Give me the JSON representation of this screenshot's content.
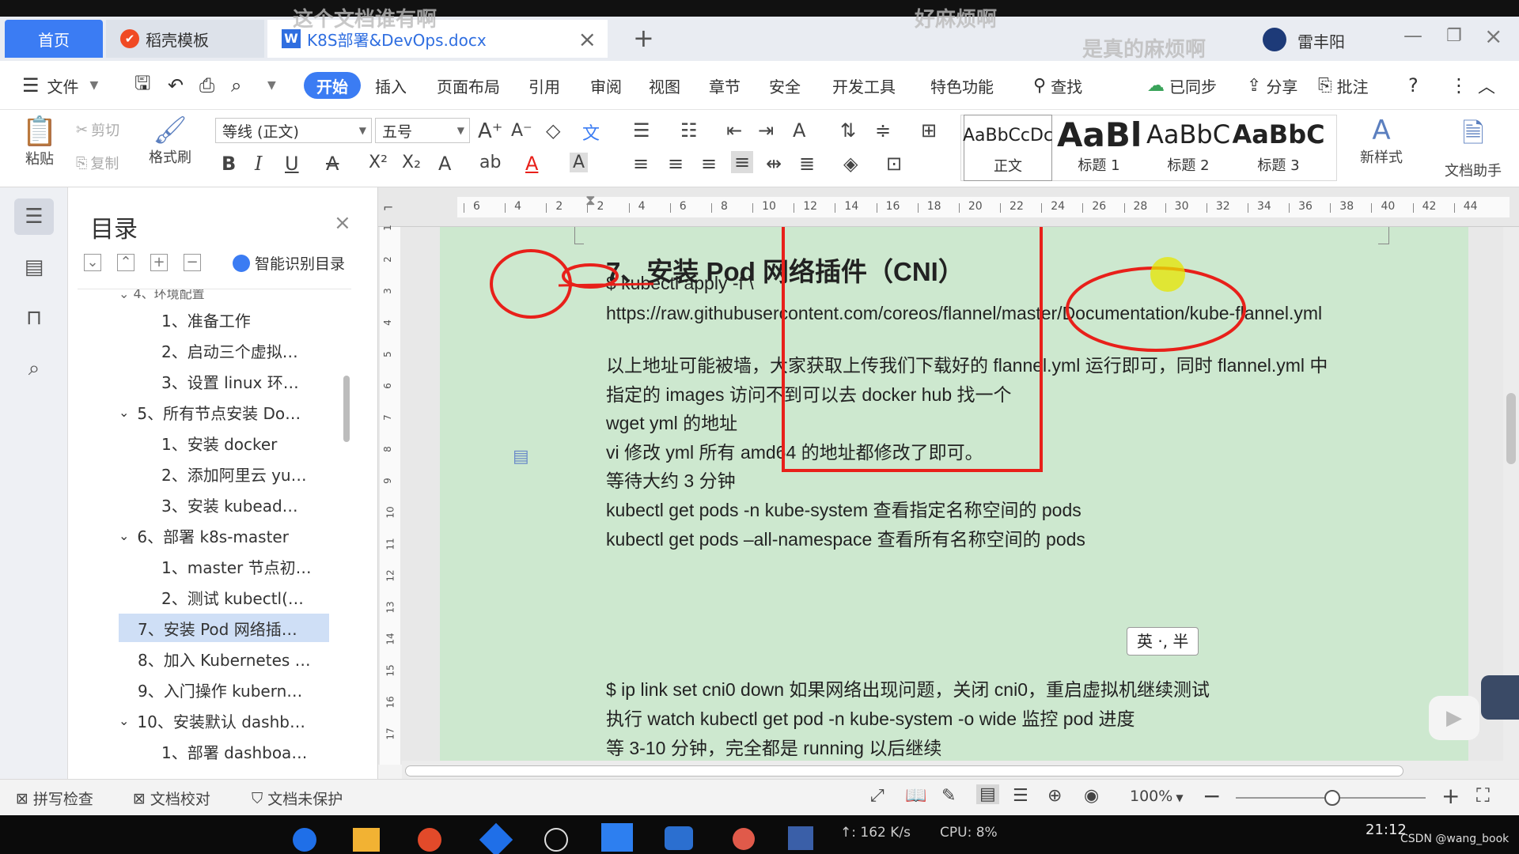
{
  "overlay": {
    "text1": "这个文档谁有啊",
    "text2": "好麻烦啊",
    "text3": "是真的麻烦啊"
  },
  "tabs": {
    "home": "首页",
    "template": "稻壳模板",
    "document": "K8S部署&DevOps.docx",
    "close": "×",
    "new": "+",
    "user": "雷丰阳"
  },
  "menu": {
    "file": "文件",
    "start": "开始",
    "insert": "插入",
    "layout": "页面布局",
    "reference": "引用",
    "review": "审阅",
    "view": "视图",
    "chapter": "章节",
    "security": "安全",
    "devtools": "开发工具",
    "features": "特色功能",
    "search": "查找",
    "synced": "已同步",
    "share": "分享",
    "comment": "批注"
  },
  "ribbon": {
    "paste": "粘贴",
    "cut": "剪切",
    "copy": "复制",
    "format_painter": "格式刷",
    "font_name": "等线 (正文)",
    "font_size": "五号",
    "styles": [
      {
        "preview": "AaBbCcDc",
        "label": "正文"
      },
      {
        "preview": "AaBl",
        "label": "标题 1"
      },
      {
        "preview": "AaBbC",
        "label": "标题 2"
      },
      {
        "preview": "AaBbC",
        "label": "标题 3"
      }
    ],
    "new_style": "新样式",
    "doc_assistant": "文档助手"
  },
  "toc": {
    "title": "目录",
    "smart": "智能识别目录",
    "items": [
      {
        "label": "1、准备工作"
      },
      {
        "label": "2、启动三个虚拟…"
      },
      {
        "label": "3、设置 linux 环…"
      },
      {
        "label": "5、所有节点安装 Do…"
      },
      {
        "label": "1、安装 docker"
      },
      {
        "label": "2、添加阿里云 yu…"
      },
      {
        "label": "3、安装 kubead…"
      },
      {
        "label": "6、部署 k8s-master"
      },
      {
        "label": "1、master 节点初…"
      },
      {
        "label": "2、测试 kubectl(…"
      },
      {
        "label": "7、安装 Pod 网络插…"
      },
      {
        "label": "8、加入 Kubernetes …"
      },
      {
        "label": "9、入门操作 kubern…"
      },
      {
        "label": "10、安装默认 dashb…"
      },
      {
        "label": "1、部署 dashboa…"
      }
    ]
  },
  "ruler": {
    "ticks": [
      "6",
      "4",
      "2",
      "2",
      "4",
      "6",
      "8",
      "10",
      "12",
      "14",
      "16",
      "18",
      "20",
      "22",
      "24",
      "26",
      "28",
      "30",
      "32",
      "34",
      "36",
      "38",
      "40",
      "42",
      "44"
    ],
    "vticks": [
      "1",
      "2",
      "3",
      "4",
      "5",
      "6",
      "7",
      "8",
      "9",
      "10",
      "11",
      "12",
      "13",
      "14",
      "15",
      "16",
      "17"
    ]
  },
  "doc": {
    "heading": "7、安装 Pod 网络插件（CNI）",
    "line1": "$ kubectl apply -f \\",
    "line2": "https://raw.githubusercontent.com/coreos/flannel/master/Documentation/kube-flannel.yml",
    "line3": "以上地址可能被墙，大家获取上传我们下载好的 flannel.yml 运行即可，同时 flannel.yml 中",
    "line4": "指定的 images 访问不到可以去 docker hub 找一个",
    "line5": "wget yml 的地址",
    "line6": "vi 修改 yml    所有 amd64 的地址都修改了即可。",
    "line7": "等待大约 3 分钟",
    "line8": "kubectl get pods -n kube-system  查看指定名称空间的 pods",
    "line9": "kubectl get pods –all-namespace  查看所有名称空间的 pods",
    "line10": "$ ip link set cni0 down  如果网络出现问题，关闭 cni0，重启虚拟机继续测试",
    "line11": "执行  watch kubectl get pod -n kube-system -o wide  监控 pod 进度",
    "line12": "等 3-10 分钟，完全都是 running 以后继续",
    "ime": "英 ·, 半"
  },
  "status": {
    "spell": "拼写检查",
    "proof": "文档校对",
    "unprotected": "文档未保护",
    "zoom": "100%"
  },
  "taskbar": {
    "net": "↑: 162 K/s",
    "cpu": "CPU: 8%",
    "time": "21:12",
    "watermark": "CSDN @wang_book"
  },
  "colors": {
    "accent": "#3b7cf3",
    "page_bg": "#cde8cf",
    "annotation": "#e8201a",
    "highlight": "#e6e600"
  }
}
